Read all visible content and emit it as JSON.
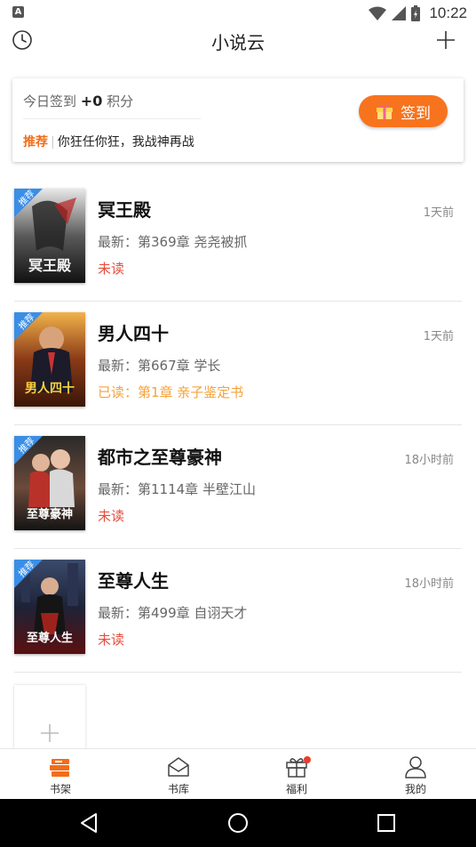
{
  "status_bar": {
    "time": "10:22",
    "app_icon_letter": "A"
  },
  "app_bar": {
    "title": "小说云"
  },
  "checkin": {
    "today_prefix": "今日签到",
    "points": "+0",
    "points_suffix": "积分",
    "rec_tag": "推荐",
    "rec_sep": "|",
    "rec_text": "你狂任你狂，我战神再战",
    "button_label": "签到"
  },
  "books": [
    {
      "title": "冥王殿",
      "time": "1天前",
      "latest": "最新：第369章 尧尧被抓",
      "status": "未读",
      "status_kind": "unread",
      "badge": "推荐",
      "cover_text": "冥王殿"
    },
    {
      "title": "男人四十",
      "time": "1天前",
      "latest": "最新：第667章 学长",
      "status": "已读：第1章 亲子鉴定书",
      "status_kind": "read",
      "badge": "推荐",
      "cover_text": "男人四十"
    },
    {
      "title": "都市之至尊豪神",
      "time": "18小时前",
      "latest": "最新：第1114章 半壁江山",
      "status": "未读",
      "status_kind": "unread",
      "badge": "推荐",
      "cover_text": "至尊豪神"
    },
    {
      "title": "至尊人生",
      "time": "18小时前",
      "latest": "最新：第499章 自诩天才",
      "status": "未读",
      "status_kind": "unread",
      "badge": "推荐",
      "cover_text": "至尊人生"
    }
  ],
  "tabs": [
    {
      "label": "书架",
      "icon": "bookshelf-icon",
      "active": true
    },
    {
      "label": "书库",
      "icon": "library-icon",
      "active": false
    },
    {
      "label": "福利",
      "icon": "gift-icon",
      "active": false,
      "has_dot": true
    },
    {
      "label": "我的",
      "icon": "profile-icon",
      "active": false
    }
  ],
  "colors": {
    "accent": "#f8731e",
    "unread": "#e74c3c",
    "read": "#f5a13a",
    "badge": "#3a8ee6"
  }
}
